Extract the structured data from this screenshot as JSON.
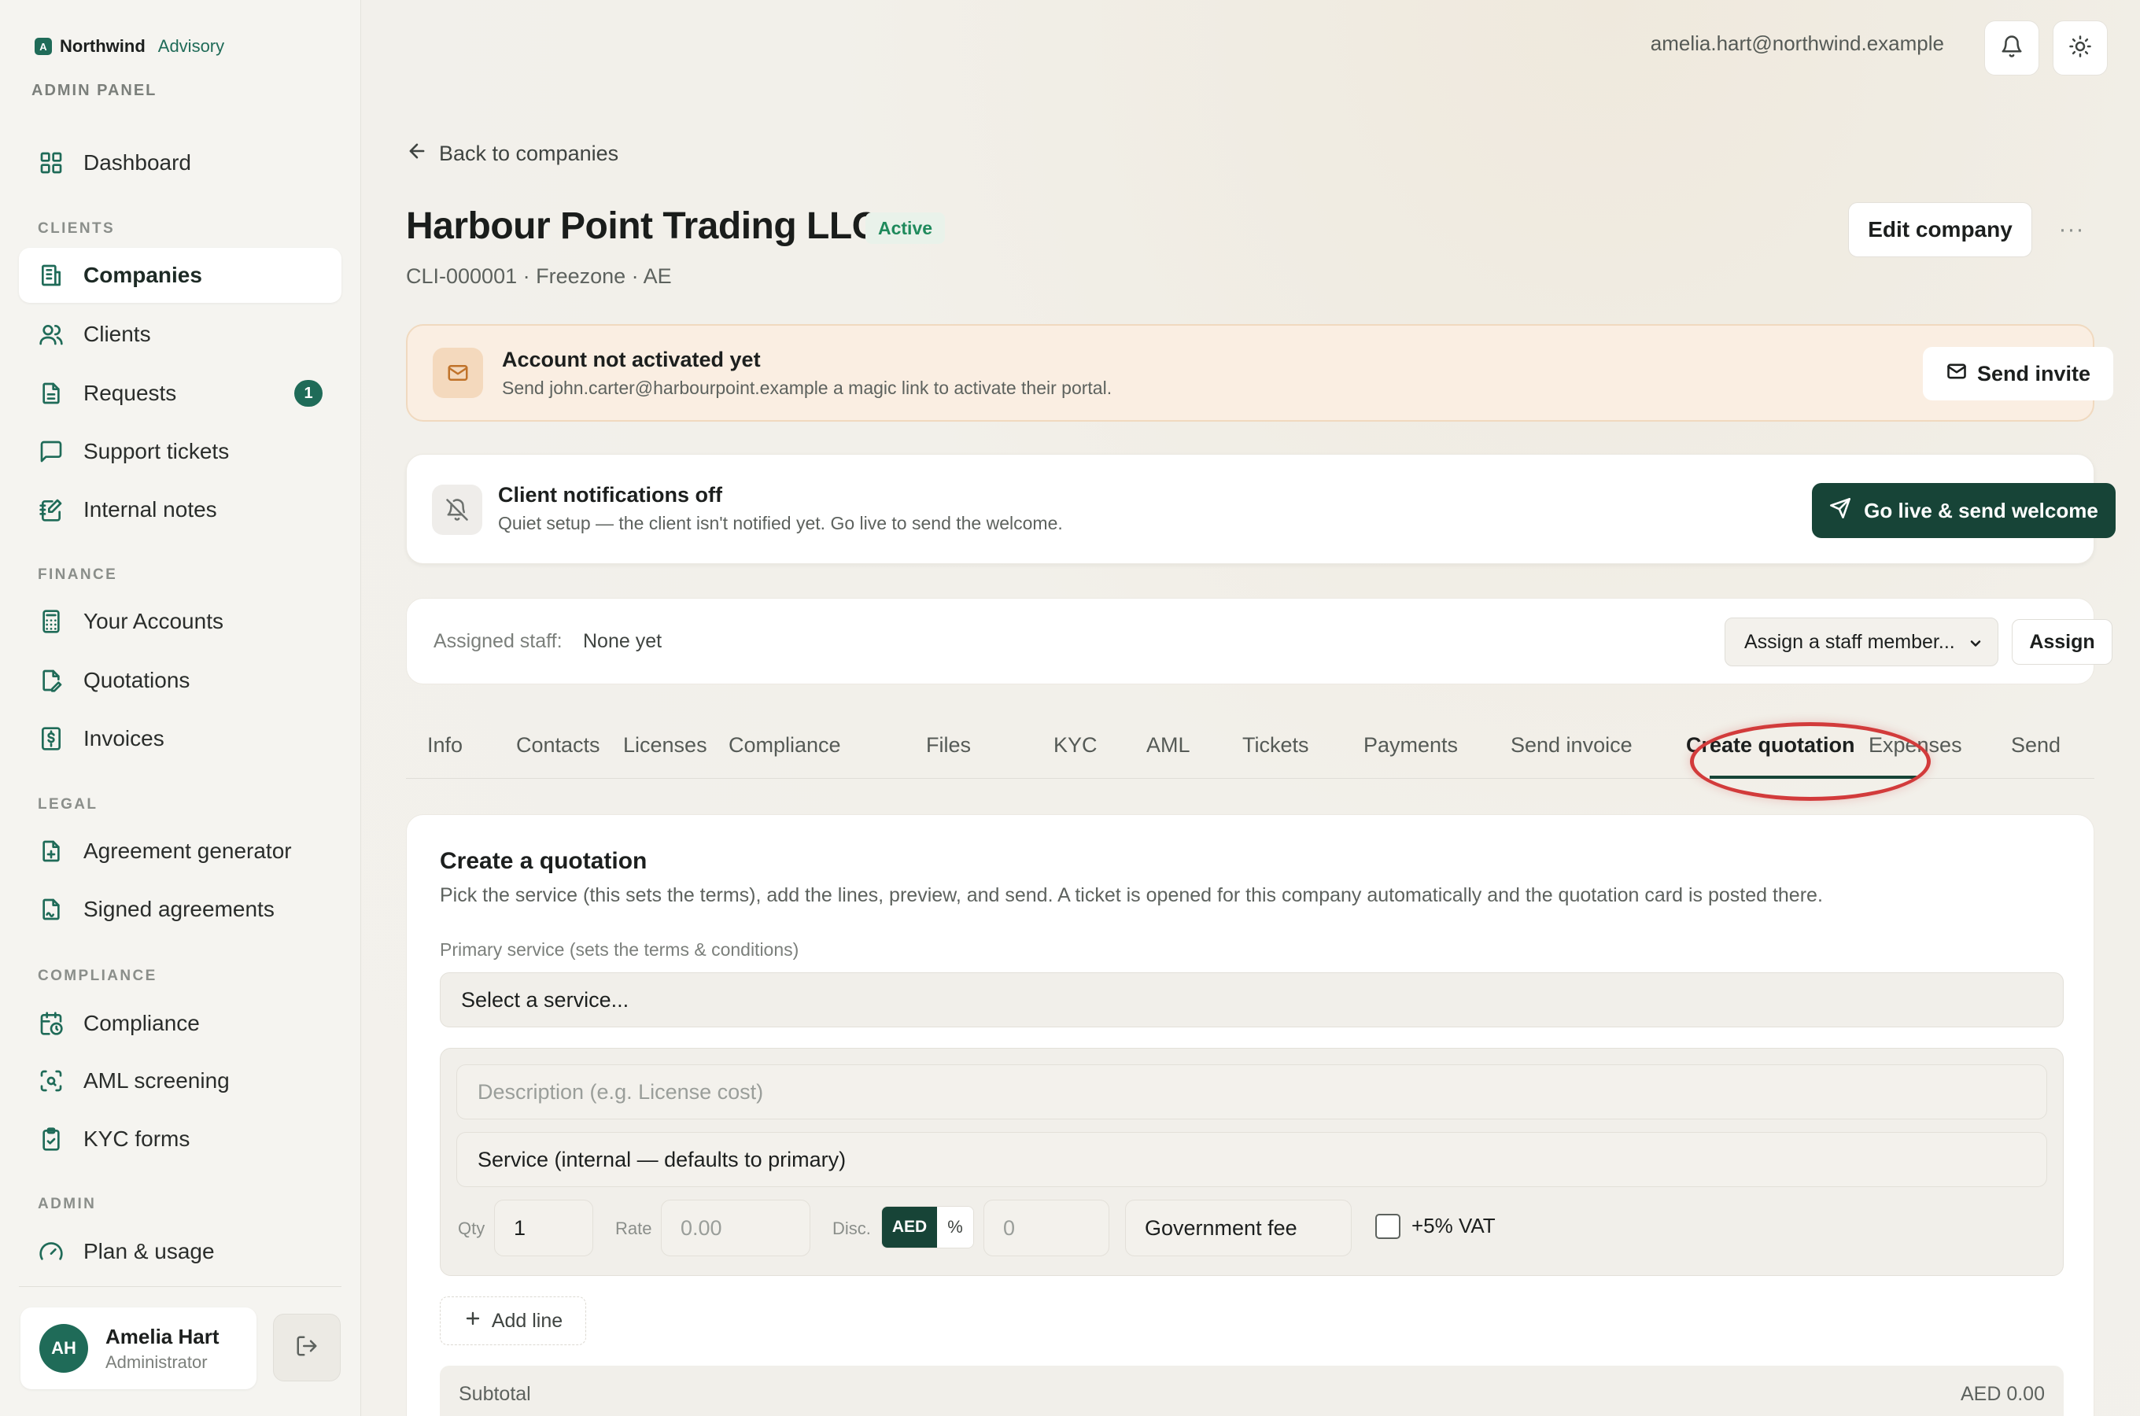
{
  "brand": {
    "logo_letter": "A",
    "name": "Northwind",
    "sub": "Advisory",
    "panel_label": "ADMIN PANEL"
  },
  "sidebar": {
    "sections": {
      "clients": "CLIENTS",
      "finance": "FINANCE",
      "legal": "LEGAL",
      "compliance": "COMPLIANCE",
      "admin": "ADMIN"
    },
    "items": {
      "dashboard": "Dashboard",
      "companies": "Companies",
      "clients": "Clients",
      "requests": "Requests",
      "requests_badge": "1",
      "support_tickets": "Support tickets",
      "internal_notes": "Internal notes",
      "your_accounts": "Your Accounts",
      "quotations": "Quotations",
      "invoices": "Invoices",
      "agreement_generator": "Agreement generator",
      "signed_agreements": "Signed agreements",
      "compliance": "Compliance",
      "aml_screening": "AML screening",
      "kyc_forms": "KYC forms",
      "plan_usage": "Plan & usage"
    },
    "user": {
      "initials": "AH",
      "name": "Amelia Hart",
      "role": "Administrator"
    }
  },
  "header": {
    "email": "amelia.hart@northwind.example"
  },
  "page": {
    "back_label": "Back to companies",
    "company_name": "Harbour Point Trading LLC",
    "status": "Active",
    "meta": "CLI-000001 · Freezone · AE",
    "edit_label": "Edit company",
    "more_label": "···"
  },
  "activation_card": {
    "title": "Account not activated yet",
    "subtitle": "Send john.carter@harbourpoint.example a magic link to activate their portal.",
    "button": "Send invite"
  },
  "notify_card": {
    "title": "Client notifications off",
    "subtitle": "Quiet setup — the client isn't notified yet. Go live to send the welcome.",
    "button": "Go live & send welcome"
  },
  "staff_card": {
    "label": "Assigned staff:",
    "value": "None yet",
    "select_value": "Assign a staff member...",
    "button": "Assign"
  },
  "tabs": [
    "Info",
    "Contacts",
    "Licenses",
    "Compliance",
    "Files",
    "KYC",
    "AML",
    "Tickets",
    "Payments",
    "Send invoice",
    "Create quotation",
    "Expenses",
    "Send"
  ],
  "active_tab": "Create quotation",
  "quotation": {
    "title": "Create a quotation",
    "description": "Pick the service (this sets the terms), add the lines, preview, and send. A ticket is opened for this company automatically and the quotation card is posted there.",
    "service_label": "Primary service (sets the terms & conditions)",
    "service_value": "Select a service...",
    "line": {
      "description_placeholder": "Description (e.g. License cost)",
      "service_value": "Service (internal — defaults to primary)",
      "qty_label": "Qty",
      "qty_value": "1",
      "rate_label": "Rate",
      "rate_placeholder": "0.00",
      "disc_label": "Disc.",
      "disc_aed": "AED",
      "disc_pct": "%",
      "disc_placeholder": "0",
      "fee_type": "Government fee",
      "vat_label": "+5% VAT"
    },
    "add_line": "Add line",
    "subtotal_label": "Subtotal",
    "subtotal_value": "AED 0.00"
  }
}
